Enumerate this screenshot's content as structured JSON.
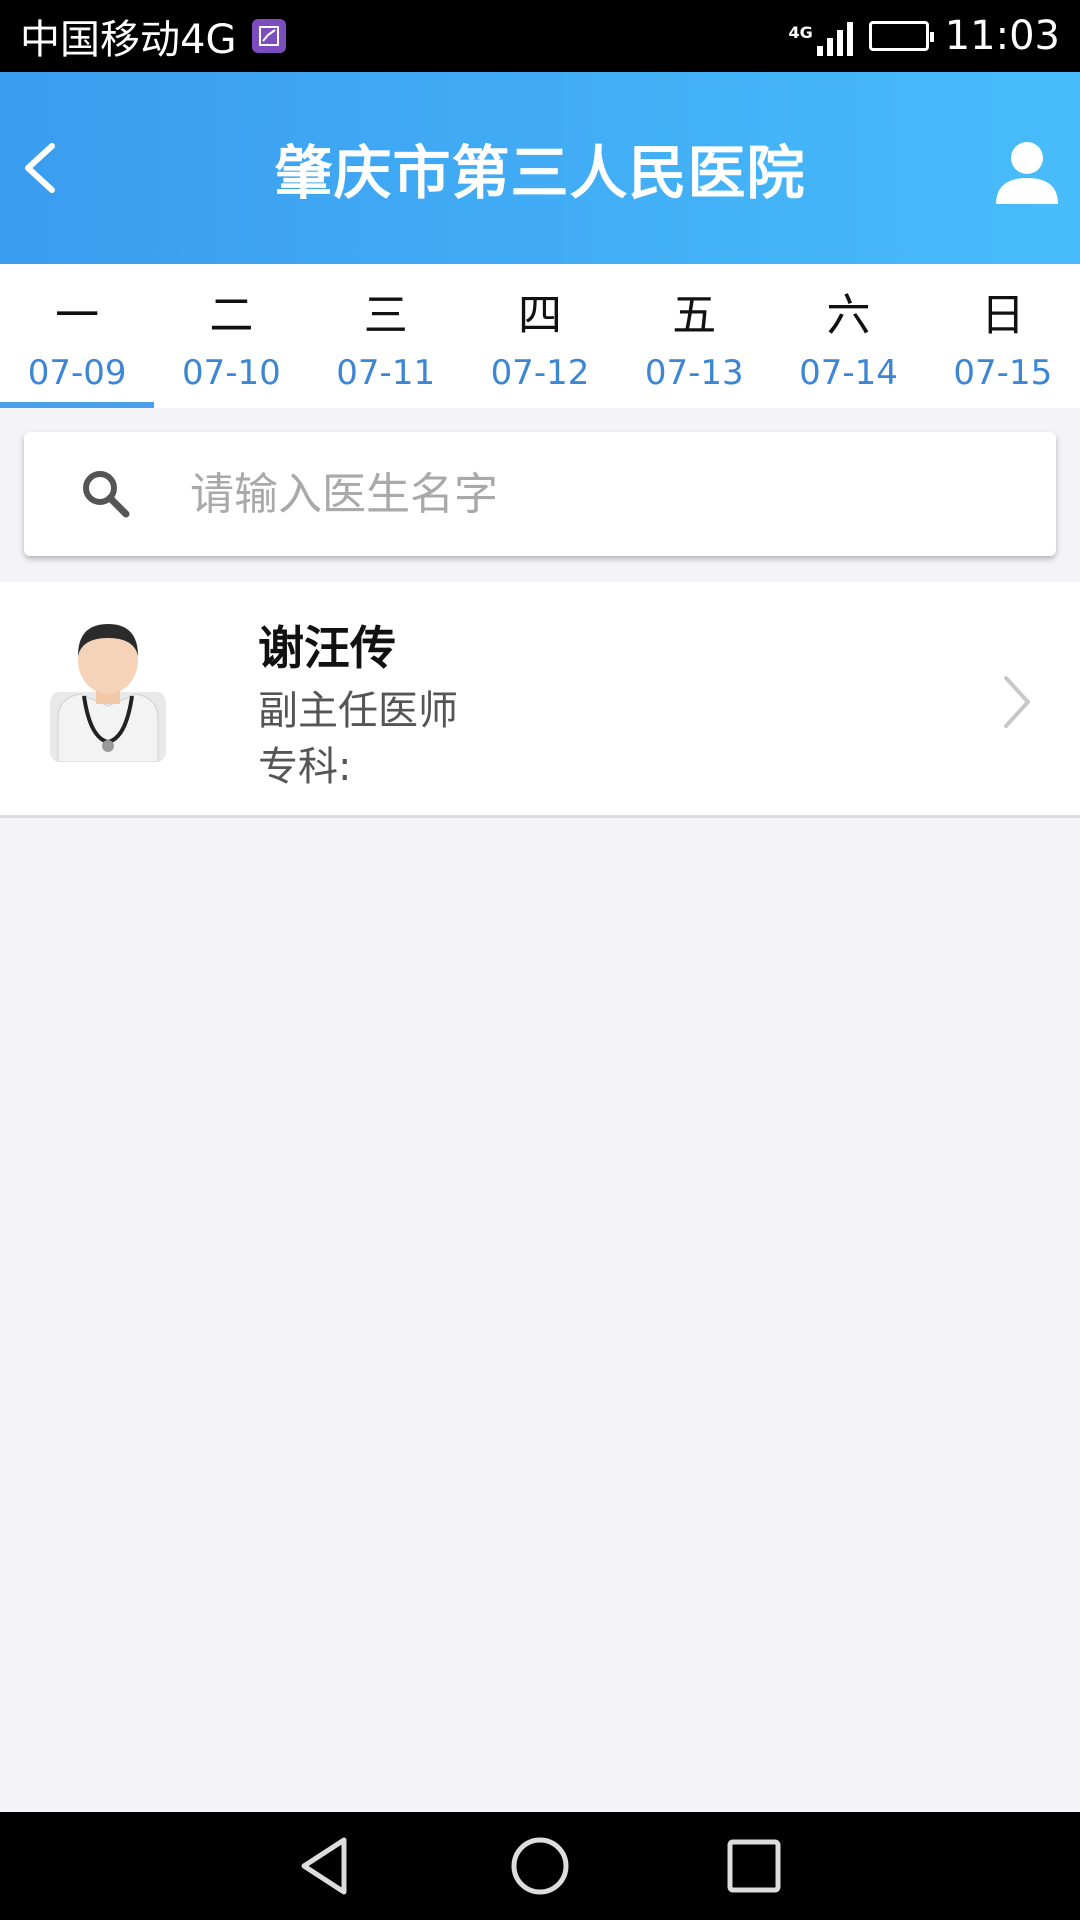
{
  "status_bar": {
    "carrier": "中国移动4G",
    "network": "4G",
    "time": "11:03"
  },
  "header": {
    "title": "肇庆市第三人民医院"
  },
  "day_tabs": [
    {
      "weekday": "一",
      "date": "07-09",
      "active": true
    },
    {
      "weekday": "二",
      "date": "07-10"
    },
    {
      "weekday": "三",
      "date": "07-11"
    },
    {
      "weekday": "四",
      "date": "07-12"
    },
    {
      "weekday": "五",
      "date": "07-13"
    },
    {
      "weekday": "六",
      "date": "07-14"
    },
    {
      "weekday": "日",
      "date": "07-15"
    }
  ],
  "search": {
    "placeholder": "请输入医生名字",
    "value": ""
  },
  "doctors": [
    {
      "name": "谢汪传",
      "title": "副主任医师",
      "specialty_label": "专科:"
    }
  ],
  "colors": {
    "header_start": "#3a9cef",
    "header_end": "#48bcfb",
    "date_text": "#3c86d4",
    "active_indicator": "#4a9fea",
    "background": "#f4f3f7"
  }
}
